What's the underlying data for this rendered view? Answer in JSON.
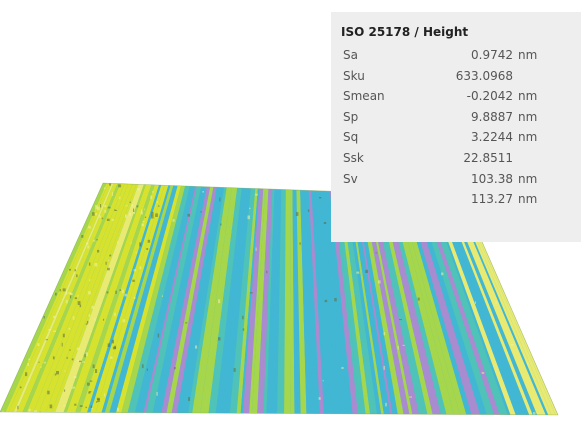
{
  "panel": {
    "title": "ISO 25178 / Height",
    "metrics": [
      {
        "name": "Sa",
        "value": "0.9742",
        "unit": "nm"
      },
      {
        "name": "Sku",
        "value": "633.0968",
        "unit": ""
      },
      {
        "name": "Smean",
        "value": "-0.2042",
        "unit": "nm"
      },
      {
        "name": "Sp",
        "value": "9.8887",
        "unit": "nm"
      },
      {
        "name": "Sq",
        "value": "3.2244",
        "unit": "nm"
      },
      {
        "name": "Ssk",
        "value": "22.8511",
        "unit": ""
      },
      {
        "name": "Sv",
        "value": "103.38",
        "unit": "nm"
      },
      {
        "name": "",
        "value": "113.27",
        "unit": "nm"
      }
    ]
  },
  "colors": {
    "panel_background": "#eeeeee",
    "yellow": "#d6e22e",
    "lime": "#a6d64c",
    "cyan": "#41b7d4",
    "teal": "#4fc3b8",
    "violet": "#a98bd0",
    "pale_yellow": "#e8ea72"
  }
}
